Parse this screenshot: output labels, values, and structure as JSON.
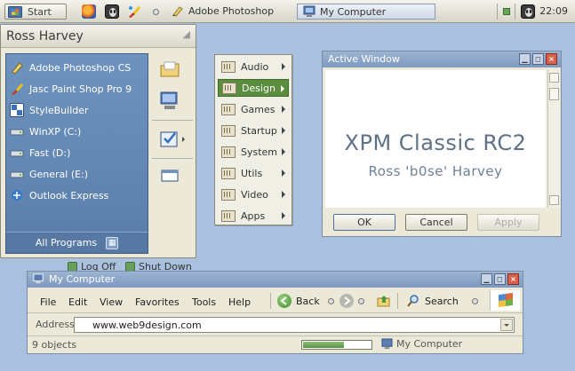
{
  "taskbar": {
    "start_label": "Start",
    "quicklaunch_icons": [
      "firefox-icon",
      "alien-icon",
      "brush-icon"
    ],
    "task_photoshop": "Adobe Photoshop",
    "task_mycomputer": "My Computer",
    "clock": "22:09"
  },
  "start_menu": {
    "user": "Ross Harvey",
    "programs": [
      {
        "label": "Adobe Photoshop CS",
        "icon": "photoshop-icon"
      },
      {
        "label": "Jasc Paint Shop Pro 9",
        "icon": "paintshop-icon"
      },
      {
        "label": "StyleBuilder",
        "icon": "stylebuilder-icon"
      },
      {
        "label": "WinXP (C:)",
        "icon": "drive-icon"
      },
      {
        "label": "Fast (D:)",
        "icon": "drive-icon"
      },
      {
        "label": "General (E:)",
        "icon": "drive-icon"
      },
      {
        "label": "Outlook Express",
        "icon": "outlook-icon"
      }
    ],
    "all_programs": "All Programs",
    "log_off": "Log Off",
    "shut_down": "Shut Down"
  },
  "submenu": {
    "items": [
      "Audio",
      "Design",
      "Games",
      "Startup",
      "System",
      "Utils",
      "Video",
      "Apps"
    ],
    "active": "Design"
  },
  "active_window": {
    "title": "Active Window",
    "heading": "XPM Classic RC2",
    "subheading": "Ross 'b0se' Harvey",
    "ok": "OK",
    "cancel": "Cancel",
    "apply": "Apply"
  },
  "explorer": {
    "title": "My Computer",
    "menus": [
      "File",
      "Edit",
      "View",
      "Favorites",
      "Tools",
      "Help"
    ],
    "back": "Back",
    "search": "Search",
    "address_label": "Address",
    "address_value": "www.web9design.com",
    "status_objects": "9 objects",
    "status_location": "My Computer",
    "progress_fraction": 0.62
  },
  "colors": {
    "desktop": "#a9c1de",
    "menu_blue": "#6e93bf",
    "highlight_green": "#5b8d3f",
    "title_blue": "#8aa5c8"
  }
}
